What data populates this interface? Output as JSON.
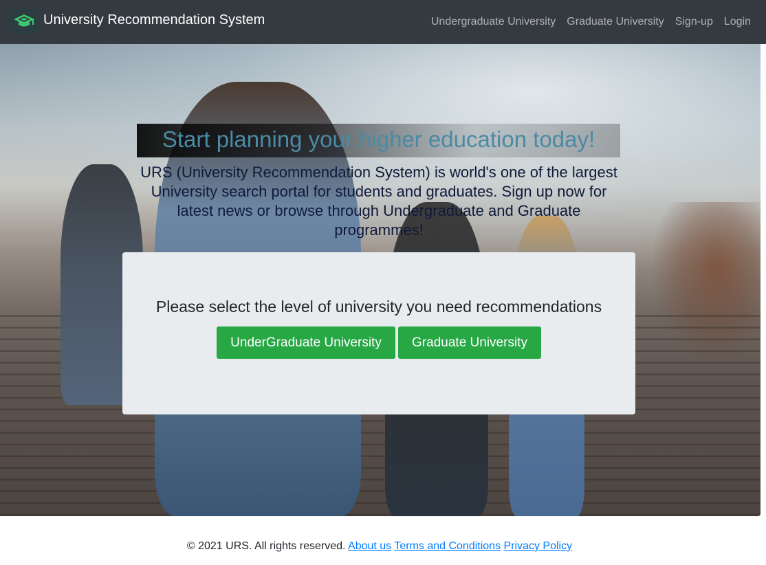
{
  "navbar": {
    "brand_title": "University Recommendation System",
    "logo_icon": "graduation-cap-icon",
    "links": [
      {
        "label": "Undergraduate University"
      },
      {
        "label": "Graduate University"
      },
      {
        "label": "Sign-up"
      },
      {
        "label": "Login"
      }
    ]
  },
  "hero": {
    "heading": "Start planning your higher education today!",
    "description": "URS (University Recommendation System) is world's one of the largest University search portal for students and graduates. Sign up now for latest news or browse through Undergraduate and Graduate programmes!"
  },
  "selection": {
    "prompt": "Please select the level of university you need recommendations",
    "undergraduate_button": "UnderGraduate University",
    "graduate_button": "Graduate University"
  },
  "footer": {
    "copyright": "© 2021 URS. All rights reserved.",
    "links": [
      {
        "label": "About us"
      },
      {
        "label": "Terms and Conditions"
      },
      {
        "label": "Privacy Policy"
      }
    ]
  },
  "colors": {
    "navbar_bg": "#343a40",
    "accent_green": "#28a745",
    "heading_blue": "#4b8aa3",
    "link_blue": "#007bff",
    "card_bg": "#e9ecef"
  }
}
